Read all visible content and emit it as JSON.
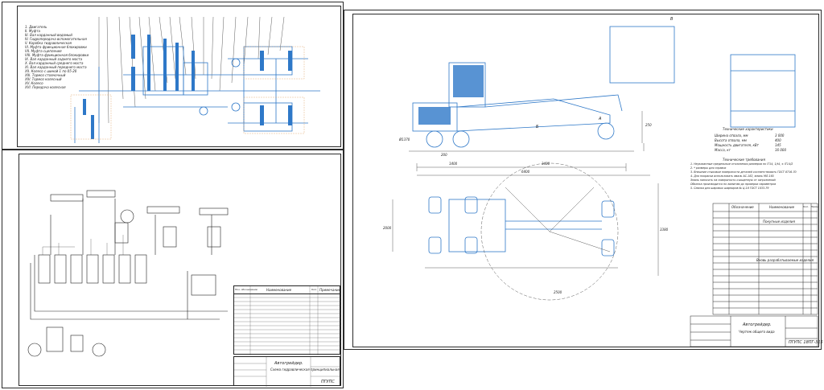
{
  "sheet1": {
    "legend": [
      "1. Двигатель",
      "II. Муфта",
      "III. Вал карданный ведомый",
      "IV. Гидропередача вспомогательная",
      "V. Коробка гидравлическая",
      "VI. Муфта фрикционная блокировки",
      "VII. Муфта сцепления",
      "VIII. Муфта фрикционная блокировки",
      "IX. Вал карданный заднего моста",
      "X. Вал карданный среднего моста",
      "XI. Вал карданный переднего моста",
      "XII. Колесо с шиной 1 по 05-20",
      "XIII. Тормоз стояночный",
      "XIV. Тормоз колесный",
      "XV. Колесо",
      "XVI. Передача колесная"
    ]
  },
  "sheet2": {
    "spec_header": [
      "Поз. обозначение",
      "Наименование",
      "Кол.",
      "Примечание"
    ],
    "title": "Автогрейдер.",
    "subtitle": "Схема гидравлическая принципиальная",
    "code": "ПГУПС"
  },
  "sheet3": {
    "dimensions": [
      "Ø1370",
      "200",
      "250",
      "1400",
      "3400",
      "6400",
      "2500",
      "3380",
      "2000"
    ],
    "tech_char_title": "Технические характеристики",
    "tech_char": [
      [
        "Ширина отвала, мм",
        "3 000"
      ],
      [
        "Высота отвала, мм",
        "400"
      ],
      [
        "Мощность двигателя, кВт",
        "145"
      ],
      [
        "Масса, кг",
        "16 000"
      ]
    ],
    "tech_req_title": "Технические требования",
    "tech_req": [
      "1. Неуказанные предельные отклонения размеров по IT14, 1/t4, ± IT14/2",
      "2. * размеры для справок",
      "3. Внешние стыковые поверхности деталей соответствовать ГОСТ 8716-70",
      "4. Для покраски использовать эмаль АС-182, эмаль МЛ-165",
      "Эмаль наносить на поверхность очищенную от загрязнений",
      "Обкатка производится по лимитам до проверки параметров",
      "5. Смазка для шаровых шарниров № Ц-18 ГОСТ 1033-79"
    ],
    "spec_header": [
      "Обозначение",
      "Наименование",
      "Кол.",
      "Прим."
    ],
    "spec_sections": [
      "Покупные изделия",
      "Вновь разрабатываемые изделия"
    ],
    "title": "Автогрейдер.",
    "subtitle": "Чертеж общего вида",
    "code": "ПГУПС 18ПГ-315",
    "letters": [
      "A",
      "Б",
      "В"
    ]
  }
}
